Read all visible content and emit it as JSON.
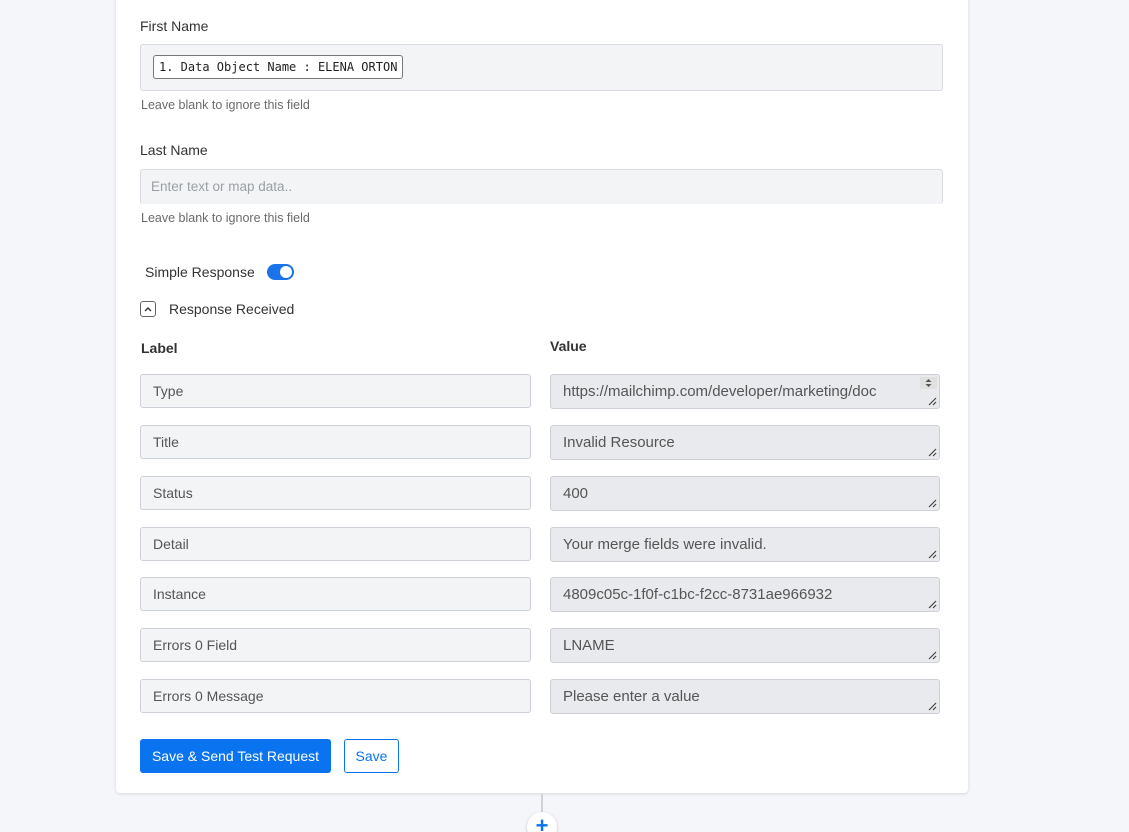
{
  "first_name": {
    "label": "First Name",
    "chip": "1. Data Object Name : ELENA ORTON",
    "help": "Leave blank to ignore this field"
  },
  "last_name": {
    "label": "Last Name",
    "placeholder": "Enter text or map data..",
    "help": "Leave blank to ignore this field"
  },
  "simple_response": {
    "label": "Simple Response",
    "enabled": true
  },
  "response": {
    "title": "Response Received",
    "label_header": "Label",
    "value_header": "Value",
    "rows": [
      {
        "label": "Type",
        "value": "https://mailchimp.com/developer/marketing/doc"
      },
      {
        "label": "Title",
        "value": "Invalid Resource"
      },
      {
        "label": "Status",
        "value": "400"
      },
      {
        "label": "Detail",
        "value": "Your merge fields were invalid."
      },
      {
        "label": "Instance",
        "value": "4809c05c-1f0f-c1bc-f2cc-8731ae966932"
      },
      {
        "label": "Errors 0 Field",
        "value": "LNAME"
      },
      {
        "label": "Errors 0 Message",
        "value": "Please enter a value"
      }
    ]
  },
  "actions": {
    "save_send": "Save & Send Test Request",
    "save": "Save"
  },
  "add_step": "+",
  "colors": {
    "primary": "#0a74f0",
    "background": "#f4f6f9"
  }
}
